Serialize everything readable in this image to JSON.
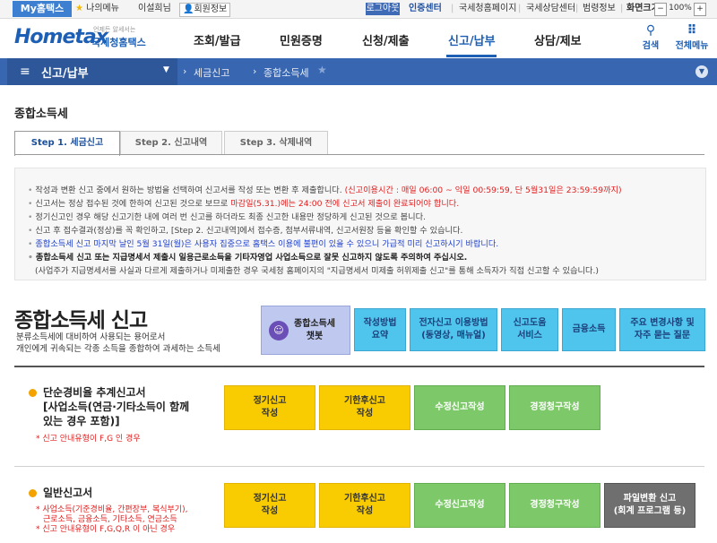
{
  "topbar": {
    "my_hometax": "My홈택스",
    "my_menu": "나의메뉴",
    "user_name": "이설희님",
    "member_info": "회원정보",
    "logout": "로그아웃",
    "cert_center": "인증센터",
    "links": [
      "국세청홈페이지",
      "국세상담센터",
      "범령정보"
    ],
    "screen_size_label": "화면크기",
    "zoom_minus": "−",
    "zoom_value": "100%",
    "zoom_plus": "+"
  },
  "header": {
    "logo_text": "Hometax",
    "logo_sub": "국세청홈택스",
    "logo_tiny": "언제든 알세서는",
    "nav": [
      "조회/발급",
      "민원증명",
      "신청/제출",
      "신고/납부",
      "상담/제보"
    ],
    "active_nav_index": 3,
    "search_label": "검색",
    "all_menu_label": "전체메뉴"
  },
  "bluebar": {
    "menu_title": "신고/납부",
    "crumbs": [
      "세금신고",
      "종합소득세"
    ]
  },
  "page": {
    "title": "종합소득세",
    "tabs": [
      "Step 1. 세금신고",
      "Step 2. 신고내역",
      "Step 3. 삭제내역"
    ],
    "active_tab_index": 0
  },
  "info": {
    "l1a": "작성과 변환 신고 중에서 원하는 방법을 선택하여 신고서를 작성 또는 변환 후 제출합니다.",
    "l1b": "(신고이용시간 : 매일 06:00 ~ 익일 00:59:59, 단 5월31일은 23:59:59까지)",
    "l2a": "신고서는 정상 접수된 것에 한하여 신고된 것으로 보므로",
    "l2b": "마감일(5.31.)에는 24:00 전에 신고서 제출이 완료되어야 합니다.",
    "l3": "정기신고인 경우 해당 신고기한 내에 여러 번 신고를 하더라도 최종 신고한 내용만 정당하게 신고된 것으로 봅니다.",
    "l4": "신고 후 접수결과(정상)를 꼭 확인하고, [Step 2. 신고내역]에서 접수증, 첨부서류내역, 신고서원장 등을 확인할 수 있습니다.",
    "l5": "종합소득세 신고 마지막 날인 5월 31일(월)은 사용자 집중으로 홈택스 이용에 불편이 있을 수 있으니 가급적 미리 신고하시기 바랍니다.",
    "l6": "종합소득세 신고 또는 지급명세서 제출시 일용근로소득을 기타자영업 사업소득으로 잘못 신고하지 않도록 주의하여 주십시오.",
    "l7": "(사업주가 지급명세서를 사실과 다르게 제출하거나 미제출한 경우 국세청 홈페이지의 \"지급명세서 미제출 허위제출 신고\"를 통해 소득자가 직접 신고할 수 있습니다.)"
  },
  "section_head": {
    "title": "종합소득세 신고",
    "desc1": "분류소득세에 대비하여 사용되는 용어로서",
    "desc2": "개인에게 귀속되는 각종 소득을 종합하여 과세하는 소득세"
  },
  "quick_buttons": {
    "chatbot1": "종합소득세",
    "chatbot2": "챗봇",
    "guide1": "작성방법",
    "guide2": "요약",
    "usage1": "전자신고 이용방법",
    "usage2": "(동영상, 매뉴얼)",
    "help1": "신고도움",
    "help2": "서비스",
    "finance": "금융소득",
    "faq1": "주요 변경사항 및",
    "faq2": "자주 묻는 질문"
  },
  "section1": {
    "title1": "단순경비율 추계신고서",
    "title2": "[사업소득(연금·기타소득이 함께",
    "title3": "있는 경우 포함)]",
    "note": "* 신고 안내유형이 F,G 인 경우",
    "btn_regular1": "정기신고",
    "btn_regular2": "작성",
    "btn_late1": "기한후신고",
    "btn_late2": "작성",
    "btn_amend": "수정신고작성",
    "btn_claim": "경정청구작성"
  },
  "section2": {
    "title": "일반신고서",
    "note1": "* 사업소득(기준경비율, 간편장부, 복식부기),",
    "note2": "근로소득, 금융소득, 기타소득, 연금소득",
    "note3": "* 신고 안내유형이 F,G,Q,R 이 아닌 경우",
    "btn_regular1": "정기신고",
    "btn_regular2": "작성",
    "btn_late1": "기한후신고",
    "btn_late2": "작성",
    "btn_amend": "수정신고작성",
    "btn_claim": "경정청구작성",
    "btn_file1": "파일변환 신고",
    "btn_file2": "(회계 프로그램 등)"
  },
  "colors": {
    "brand_blue": "#1c5fb5",
    "bar_blue": "#3866b0",
    "quick_cyan": "#4fc5ee",
    "action_yellow": "#f8cc00",
    "action_green": "#7dc96a",
    "action_gray": "#6f6f6f",
    "notice_red": "#e02020"
  }
}
